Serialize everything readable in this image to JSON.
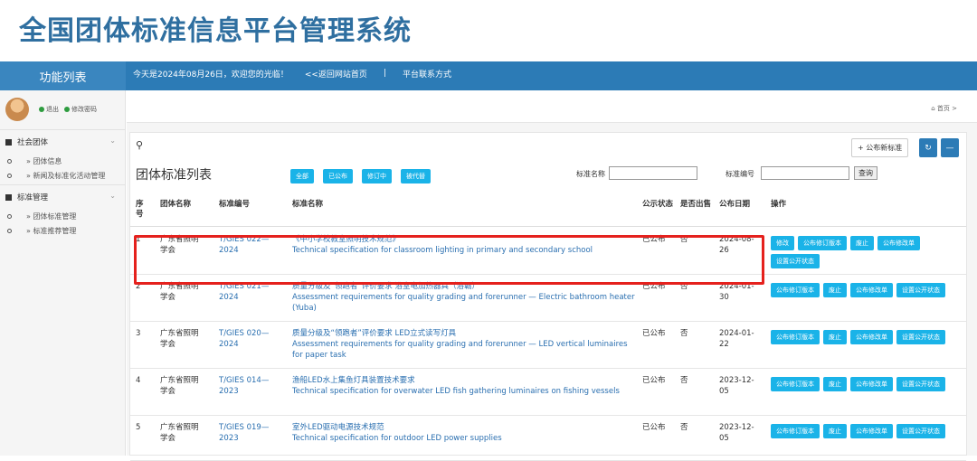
{
  "header": {
    "site_title": "全国团体标准信息平台管理系统"
  },
  "topbar": {
    "sidebar_heading": "功能列表",
    "welcome": "今天是2024年08月26日，欢迎您的光临！",
    "back_home": "<<返回网站首页",
    "separator": "|",
    "contact": "平台联系方式"
  },
  "user": {
    "logout": "退出",
    "change_password": "修改密码"
  },
  "sidebar": {
    "groups": [
      {
        "label": "社会团体",
        "items": [
          "» 团体信息",
          "» 新闻及标准化活动管理"
        ]
      },
      {
        "label": "标准管理",
        "items": [
          "» 团体标准管理",
          "» 标准推荐管理"
        ]
      }
    ]
  },
  "breadcrumb": {
    "label": "首页",
    "arrow": ">"
  },
  "panel": {
    "title": "团体标准列表",
    "publish_new": "+ 公布新标准",
    "filters": [
      "全部",
      "已公布",
      "修订中",
      "被代替"
    ],
    "search_name_label": "标准名称",
    "search_no_label": "标准编号",
    "query_label": "查询"
  },
  "table": {
    "headers": {
      "no": "序号",
      "org": "团体名称",
      "code": "标准编号",
      "name": "标准名称",
      "status": "公示状态",
      "sale": "是否出售",
      "date": "公布日期",
      "ops": "操作"
    },
    "rows": [
      {
        "no": "1",
        "org": "广东省照明学会",
        "code": "T/GIES 022—2024",
        "name_cn": "《中小学校教室照明技术规范》",
        "name_en": "Technical specification for classroom lighting in primary and secondary school",
        "status": "已公布",
        "sale": "否",
        "date": "2024-08-26",
        "ops": [
          "修改",
          "公布修订版本",
          "废止",
          "公布修改单",
          "设置公开状态"
        ]
      },
      {
        "no": "2",
        "org": "广东省照明学会",
        "code": "T/GIES 021—2024",
        "name_cn": "质量分级及“领跑者”评价要求 浴室电加热器具（浴霸）",
        "name_en": "Assessment requirements for quality grading and forerunner — Electric bathroom heater (Yuba)",
        "status": "已公布",
        "sale": "否",
        "date": "2024-01-30",
        "ops": [
          "公布修订版本",
          "废止",
          "公布修改单",
          "设置公开状态"
        ]
      },
      {
        "no": "3",
        "org": "广东省照明学会",
        "code": "T/GIES 020—2024",
        "name_cn": "质量分级及“领跑者”评价要求 LED立式读写灯具",
        "name_en": "Assessment requirements for quality grading and forerunner — LED vertical luminaires for paper task",
        "status": "已公布",
        "sale": "否",
        "date": "2024-01-22",
        "ops": [
          "公布修订版本",
          "废止",
          "公布修改单",
          "设置公开状态"
        ]
      },
      {
        "no": "4",
        "org": "广东省照明学会",
        "code": "T/GIES 014—2023",
        "name_cn": "渔船LED水上集鱼灯具装置技术要求",
        "name_en": "Technical specification for overwater LED fish gathering luminaires on fishing vessels",
        "status": "已公布",
        "sale": "否",
        "date": "2023-12-05",
        "ops": [
          "公布修订版本",
          "废止",
          "公布修改单",
          "设置公开状态"
        ]
      },
      {
        "no": "5",
        "org": "广东省照明学会",
        "code": "T/GIES 019—2023",
        "name_cn": "室外LED驱动电源技术规范",
        "name_en": "Technical specification for outdoor LED power supplies",
        "status": "已公布",
        "sale": "否",
        "date": "2023-12-05",
        "ops": [
          "公布修订版本",
          "废止",
          "公布修改单",
          "设置公开状态"
        ]
      }
    ]
  },
  "colors": {
    "accent": "#2c7bb6",
    "button": "#1ab3e8",
    "highlight": "#e5211d",
    "title": "#2f6fa0"
  }
}
